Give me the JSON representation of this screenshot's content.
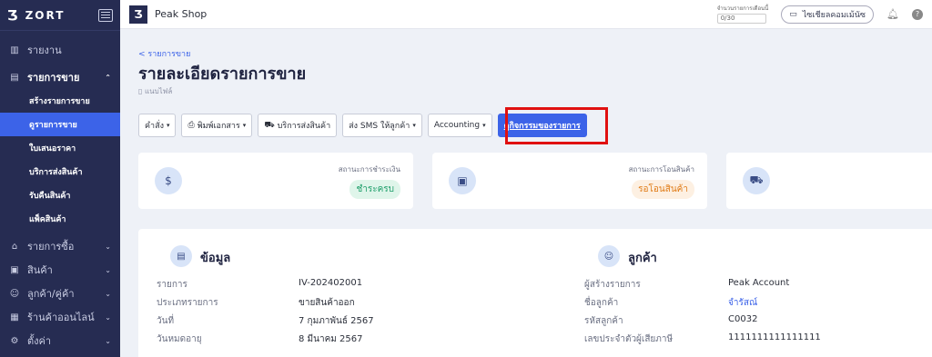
{
  "brand": {
    "logo": "Ʒ",
    "name": "ZORT"
  },
  "sidebar": {
    "items": [
      {
        "icon": "▥",
        "label": "รายงาน"
      },
      {
        "icon": "▤",
        "label": "รายการขาย"
      }
    ],
    "sub_items": [
      "สร้างรายการขาย",
      "ดูรายการขาย",
      "ใบเสนอราคา",
      "บริการส่งสินค้า",
      "รับคืนสินค้า",
      "แพ็คสินค้า"
    ],
    "more": [
      {
        "icon": "⌂",
        "label": "รายการซื้อ"
      },
      {
        "icon": "▣",
        "label": "สินค้า"
      },
      {
        "icon": "☺",
        "label": "ลูกค้า/คู่ค้า"
      },
      {
        "icon": "▦",
        "label": "ร้านค้าออนไลน์"
      },
      {
        "icon": "⚙",
        "label": "ตั้งค่า"
      }
    ]
  },
  "topbar": {
    "shop_logo": "Ʒ",
    "shop_name": "Peak Shop",
    "counter_label": "จำนวนรายการเดือนนี้",
    "counter_value": "0/30",
    "invite_label": "ไซเชียลคอมเม้นัซ",
    "help": "?"
  },
  "page": {
    "breadcrumb": "< รายการขาย",
    "title": "รายละเอียดรายการขาย",
    "attach": "แนบไฟล์"
  },
  "toolbar": {
    "command": "คำสั่ง",
    "print": "พิมพ์เอกสาร",
    "shipping": "บริการส่งสินค้า",
    "sms": "ส่ง SMS ให้ลูกค้า",
    "accounting": "Accounting",
    "activity": "ดูกิจกรรมของรายการ"
  },
  "status": {
    "payment_label": "สถานะการชำระเงิน",
    "payment_value": "ชำระครบ",
    "payment_color": "#1e9e6a",
    "transfer_label": "สถานะการโอนสินค้า",
    "transfer_value": "รอโอนสินค้า",
    "transfer_color": "#e07b16"
  },
  "info": {
    "title": "ข้อมูล",
    "rows": [
      {
        "key": "รายการ",
        "value": "IV-202402001"
      },
      {
        "key": "ประเภทรายการ",
        "value": "ขายสินค้าออก"
      },
      {
        "key": "วันที่",
        "value": "7 กุมภาพันธ์ 2567"
      },
      {
        "key": "วันหมดอายุ",
        "value": "8 มีนาคม 2567"
      }
    ]
  },
  "customer": {
    "title": "ลูกค้า",
    "rows": [
      {
        "key": "ผู้สร้างรายการ",
        "value": "Peak Account"
      },
      {
        "key": "ชื่อลูกค้า",
        "value": "จำรัสณ์"
      },
      {
        "key": "รหัสลูกค้า",
        "value": "C0032"
      },
      {
        "key": "เลขประจำตัวผู้เสียภาษี",
        "value": "1111111111111111"
      }
    ]
  }
}
